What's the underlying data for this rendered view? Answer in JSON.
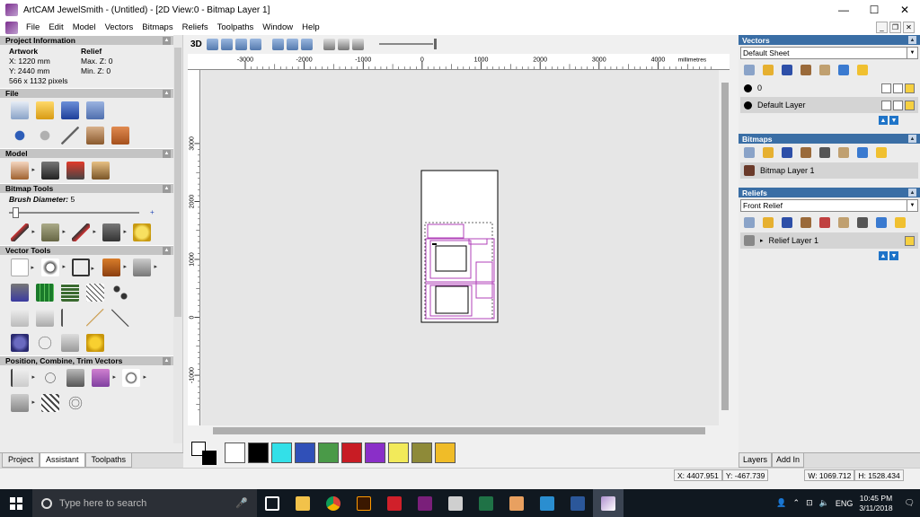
{
  "window": {
    "title": "ArtCAM JewelSmith - (Untitled) - [2D View:0 - Bitmap Layer 1]"
  },
  "menu": [
    "File",
    "Edit",
    "Model",
    "Vectors",
    "Bitmaps",
    "Reliefs",
    "Toolpaths",
    "Window",
    "Help"
  ],
  "left": {
    "project_info": {
      "header": "Project Information",
      "artwork_label": "Artwork",
      "relief_label": "Relief",
      "x": "X: 1220 mm",
      "y": "Y: 2440 mm",
      "pixels": "566 x 1132 pixels",
      "maxz": "Max. Z: 0",
      "minz": "Min. Z: 0"
    },
    "file_header": "File",
    "model_header": "Model",
    "bitmap_tools": {
      "header": "Bitmap Tools",
      "brush_label": "Brush Diameter:",
      "brush_value": "5"
    },
    "vector_tools_header": "Vector Tools",
    "position_header": "Position, Combine, Trim Vectors",
    "tabs": [
      "Project",
      "Assistant",
      "Toolpaths"
    ]
  },
  "view": {
    "three_d": "3D",
    "h_ticks": [
      "-3000",
      "-2000",
      "-1000",
      "0",
      "1000",
      "2000",
      "3000",
      "4000"
    ],
    "h_units": "millimetres",
    "v_ticks": [
      "3000",
      "2000",
      "1000",
      "0",
      "-1000"
    ]
  },
  "palette": [
    "#ffffff",
    "#000000",
    "#33e0e8",
    "#3050b8",
    "#4a9a48",
    "#c81c24",
    "#8a2fc8",
    "#f2ea5a",
    "#8e8a38",
    "#f0bc28"
  ],
  "right": {
    "vectors": {
      "header": "Vectors",
      "sheet": "Default Sheet",
      "layers": [
        "0",
        "Default Layer"
      ]
    },
    "bitmaps": {
      "header": "Bitmaps",
      "layers": [
        "Bitmap Layer 1"
      ]
    },
    "reliefs": {
      "header": "Reliefs",
      "relief": "Front Relief",
      "layers": [
        "Relief Layer 1"
      ]
    },
    "tabs": [
      "Layers",
      "Add In"
    ]
  },
  "status": {
    "x": "X: 4407.951",
    "y": "Y: -467.739",
    "w": "W: 1069.712",
    "h": "H: 1528.434"
  },
  "taskbar": {
    "search_placeholder": "Type here to search",
    "lang": "ENG",
    "time": "10:45 PM",
    "date": "3/11/2018"
  }
}
